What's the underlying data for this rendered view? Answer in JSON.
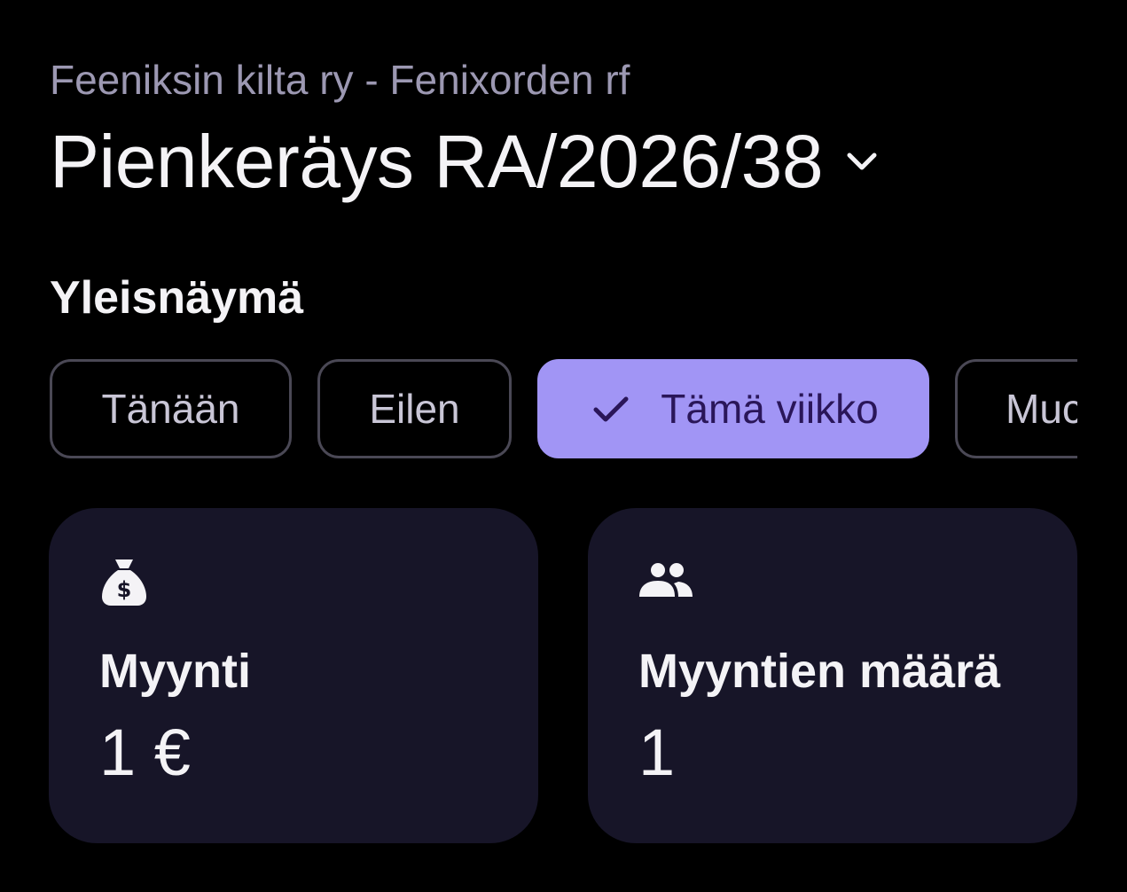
{
  "header": {
    "organization": "Feeniksin kilta ry - Fenixorden rf",
    "fundraiser_title": "Pienkeräys RA/2026/38",
    "dropdown_icon": "chevron-down-icon"
  },
  "overview": {
    "section_title": "Yleisnäymä",
    "filters": [
      {
        "label": "Tänään",
        "selected": false
      },
      {
        "label": "Eilen",
        "selected": false
      },
      {
        "label": "Tämä viikko",
        "selected": true,
        "icon": "check-icon"
      },
      {
        "label": "Muc",
        "selected": false
      }
    ],
    "cards": [
      {
        "icon": "money-bag-icon",
        "label": "Myynti",
        "value": "1 €"
      },
      {
        "icon": "people-icon",
        "label": "Myyntien määrä",
        "value": "1"
      }
    ]
  },
  "colors": {
    "background": "#000000",
    "card_background": "#171528",
    "accent": "#a195f5",
    "accent_text": "#2a1659",
    "muted_text": "#9c98b2"
  }
}
